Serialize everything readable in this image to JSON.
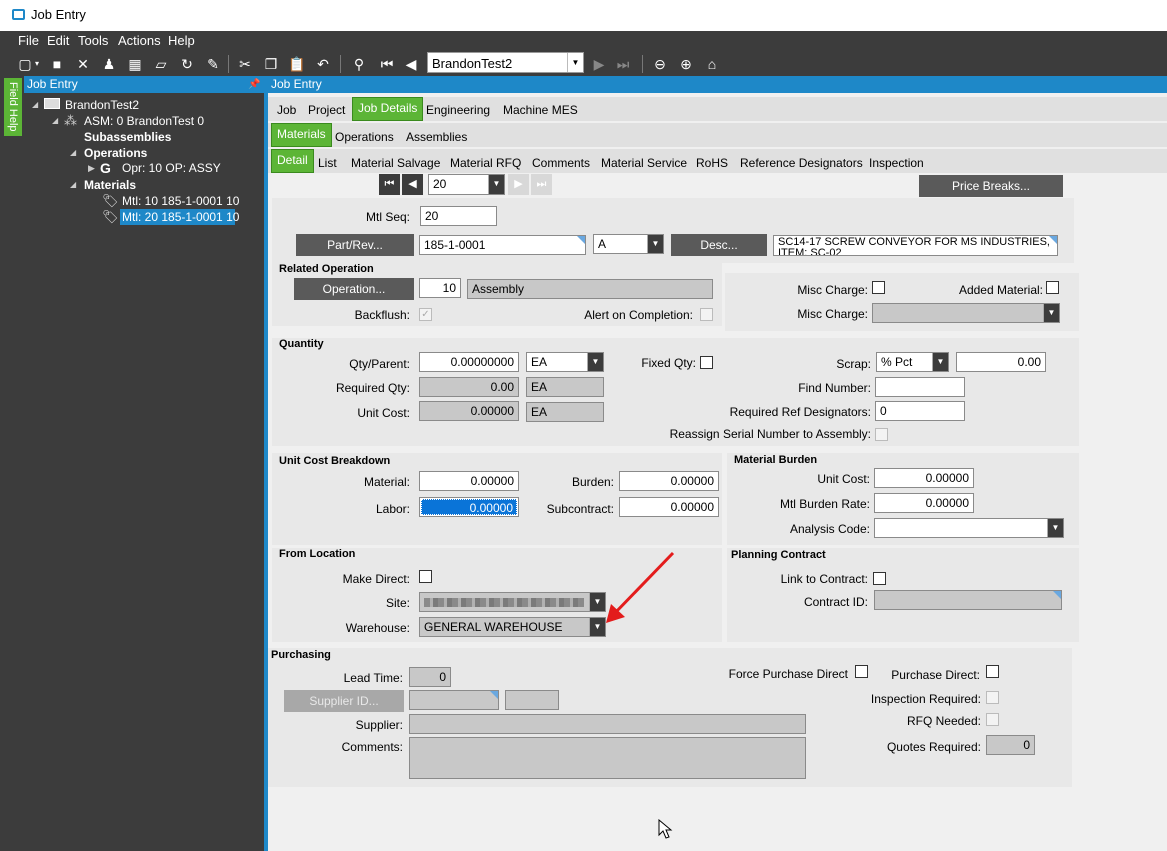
{
  "window": {
    "title": "Job Entry"
  },
  "menu": [
    "File",
    "Edit",
    "Tools",
    "Actions",
    "Help"
  ],
  "toolbar": {
    "job_combo": "BrandonTest2"
  },
  "side": {
    "field_help": "Field Help"
  },
  "tree_panel": {
    "title": "Job Entry",
    "pin": "📌",
    "nodes": {
      "job": "BrandonTest2",
      "asm": "ASM: 0 BrandonTest 0",
      "subassemblies": "Subassemblies",
      "operations": "Operations",
      "opr": "Opr: 10 OP: ASSY",
      "materials": "Materials",
      "mtl10": "Mtl: 10 185-1-0001 10",
      "mtl20": "Mtl: 20 185-1-0001 10"
    }
  },
  "main": {
    "title": "Job Entry",
    "tabs1": [
      "Job",
      "Project",
      "Job Details",
      "Engineering",
      "Machine MES"
    ],
    "tabs2": [
      "Materials",
      "Operations",
      "Assemblies"
    ],
    "tabs3": [
      "Detail",
      "List",
      "Material Salvage",
      "Material RFQ",
      "Comments",
      "Material Service",
      "RoHS",
      "Reference Designators",
      "Inspection"
    ],
    "nav_value": "20",
    "price_breaks": "Price Breaks...",
    "mtl_seq_label": "Mtl Seq:",
    "mtl_seq": "20",
    "part_rev_btn": "Part/Rev...",
    "part": "185-1-0001",
    "rev": "A",
    "desc_btn": "Desc...",
    "desc": "SC14-17 SCREW CONVEYOR FOR MS INDUSTRIES, ITEM: SC-02",
    "related_op": {
      "header": "Related Operation",
      "op_btn": "Operation...",
      "op_num": "10",
      "op_desc": "Assembly",
      "backflush": "Backflush:",
      "alert": "Alert on Completion:"
    },
    "misc": {
      "misc_charge_chk": "Misc Charge:",
      "added_material": "Added Material:",
      "misc_charge_dd": "Misc Charge:"
    },
    "quantity": {
      "header": "Quantity",
      "qty_parent": "Qty/Parent:",
      "qty_parent_val": "0.00000000",
      "qty_uom": "EA",
      "fixed_qty": "Fixed Qty:",
      "scrap": "Scrap:",
      "scrap_type": "% Pct",
      "scrap_val": "0.00",
      "required_qty": "Required Qty:",
      "required_qty_val": "0.00",
      "required_uom": "EA",
      "find_number": "Find Number:",
      "unit_cost": "Unit Cost:",
      "unit_cost_val": "0.00000",
      "unit_cost_uom": "EA",
      "req_ref": "Required Ref Designators:",
      "req_ref_val": "0",
      "reassign": "Reassign Serial Number to Assembly:"
    },
    "ucb": {
      "header": "Unit Cost Breakdown",
      "material": "Material:",
      "material_val": "0.00000",
      "burden": "Burden:",
      "burden_val": "0.00000",
      "labor": "Labor:",
      "labor_val": "0.00000",
      "subcontract": "Subcontract:",
      "subcontract_val": "0.00000"
    },
    "mat_burden": {
      "header": "Material Burden",
      "unit_cost": "Unit Cost:",
      "unit_cost_val": "0.00000",
      "rate": "Mtl  Burden Rate:",
      "rate_val": "0.00000",
      "analysis": "Analysis Code:"
    },
    "from_loc": {
      "header": "From Location",
      "make_direct": "Make Direct:",
      "site": "Site:",
      "warehouse": "Warehouse:",
      "warehouse_val": "GENERAL WAREHOUSE"
    },
    "planning": {
      "header": "Planning Contract",
      "link": "Link to Contract:",
      "contract_id": "Contract ID:"
    },
    "purchasing": {
      "header": "Purchasing",
      "lead_time": "Lead Time:",
      "lead_time_val": "0",
      "force_direct": "Force Purchase Direct",
      "purchase_direct": "Purchase Direct:",
      "supplier_id_btn": "Supplier ID...",
      "inspection": "Inspection  Required:",
      "supplier": "Supplier:",
      "rfq": "RFQ Needed:",
      "comments": "Comments:",
      "quotes": "Quotes Required:",
      "quotes_val": "0"
    }
  },
  "colors": {
    "accent_green": "#5cb536",
    "accent_blue": "#1e88c8",
    "dark": "#3c3c3c",
    "arrow_red": "#e31c1c"
  }
}
